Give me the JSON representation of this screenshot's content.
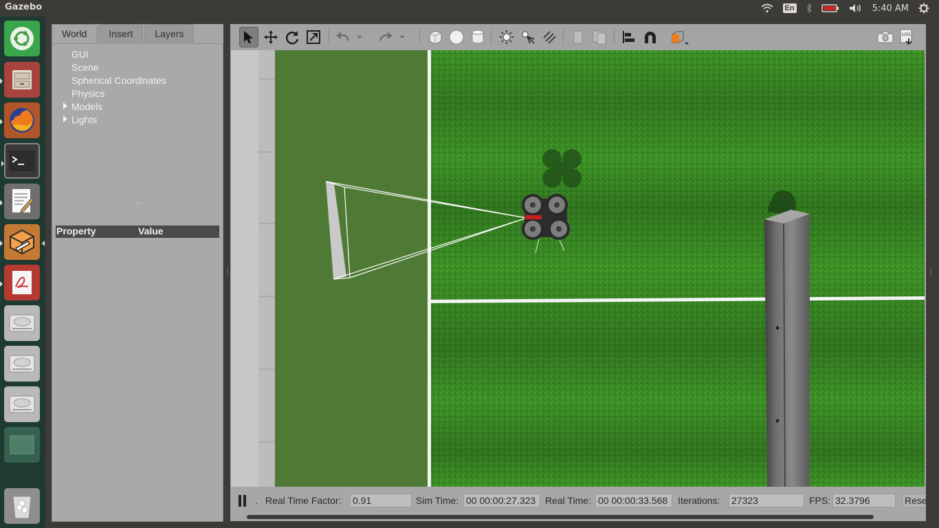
{
  "app": {
    "title": "Gazebo"
  },
  "tray": {
    "wifi_icon": "wifi-icon",
    "lang": "En",
    "bluetooth_icon": "bluetooth-icon",
    "battery_icon": "battery-icon",
    "volume_icon": "volume-icon",
    "clock": "5:40 AM",
    "settings_icon": "gear-icon"
  },
  "launcher": [
    {
      "name": "ubuntu-dash",
      "icon": "ubuntu-logo-icon"
    },
    {
      "name": "files",
      "icon": "file-cabinet-icon"
    },
    {
      "name": "firefox",
      "icon": "firefox-icon"
    },
    {
      "name": "terminal",
      "icon": "terminal-icon"
    },
    {
      "name": "text-editor",
      "icon": "text-editor-icon"
    },
    {
      "name": "gazebo",
      "icon": "gazebo-icon"
    },
    {
      "name": "pdf-viewer",
      "icon": "pdf-icon"
    },
    {
      "name": "drive-1",
      "icon": "hard-drive-icon"
    },
    {
      "name": "drive-2",
      "icon": "hard-drive-icon"
    },
    {
      "name": "drive-3",
      "icon": "hard-drive-icon"
    },
    {
      "name": "workspace",
      "icon": "workspace-icon"
    },
    {
      "name": "trash",
      "icon": "trash-icon"
    }
  ],
  "left_panel": {
    "tabs": [
      "World",
      "Insert",
      "Layers"
    ],
    "active_tab": "World",
    "tree": [
      {
        "label": "GUI",
        "expandable": false
      },
      {
        "label": "Scene",
        "expandable": false
      },
      {
        "label": "Spherical Coordinates",
        "expandable": false
      },
      {
        "label": "Physics",
        "expandable": false
      },
      {
        "label": "Models",
        "expandable": true
      },
      {
        "label": "Lights",
        "expandable": true
      }
    ],
    "property_header": {
      "property": "Property",
      "value": "Value"
    }
  },
  "toolbar": {
    "tools": [
      "select-arrow-icon",
      "translate-icon",
      "rotate-icon",
      "scale-icon",
      "undo-icon",
      "undo-dropdown-icon",
      "redo-icon",
      "redo-dropdown-icon",
      "box-icon",
      "sphere-icon",
      "cylinder-icon",
      "point-light-icon",
      "spot-light-icon",
      "directional-light-icon",
      "copy-icon",
      "paste-icon",
      "align-icon",
      "snap-icon",
      "view-angle-icon",
      "screenshot-icon",
      "log-icon"
    ]
  },
  "status": {
    "pause_icon": "pause-icon",
    "step": ".",
    "rtf_label": "Real Time Factor:",
    "rtf_value": "0.91",
    "sim_time_label": "Sim Time:",
    "sim_time_value": "00 00:00:27.323",
    "real_time_label": "Real Time:",
    "real_time_value": "00 00:00:33.568",
    "iterations_label": "Iterations:",
    "iterations_value": "27323",
    "fps_label": "FPS:",
    "fps_value": "32.3796",
    "reset_label": "Rese"
  },
  "colors": {
    "topbar": "#3c3b37",
    "launcher": "#1e3a33",
    "panel": "#a7a7a7",
    "grass": "#3b8e25",
    "lane": "#4f7a36"
  }
}
